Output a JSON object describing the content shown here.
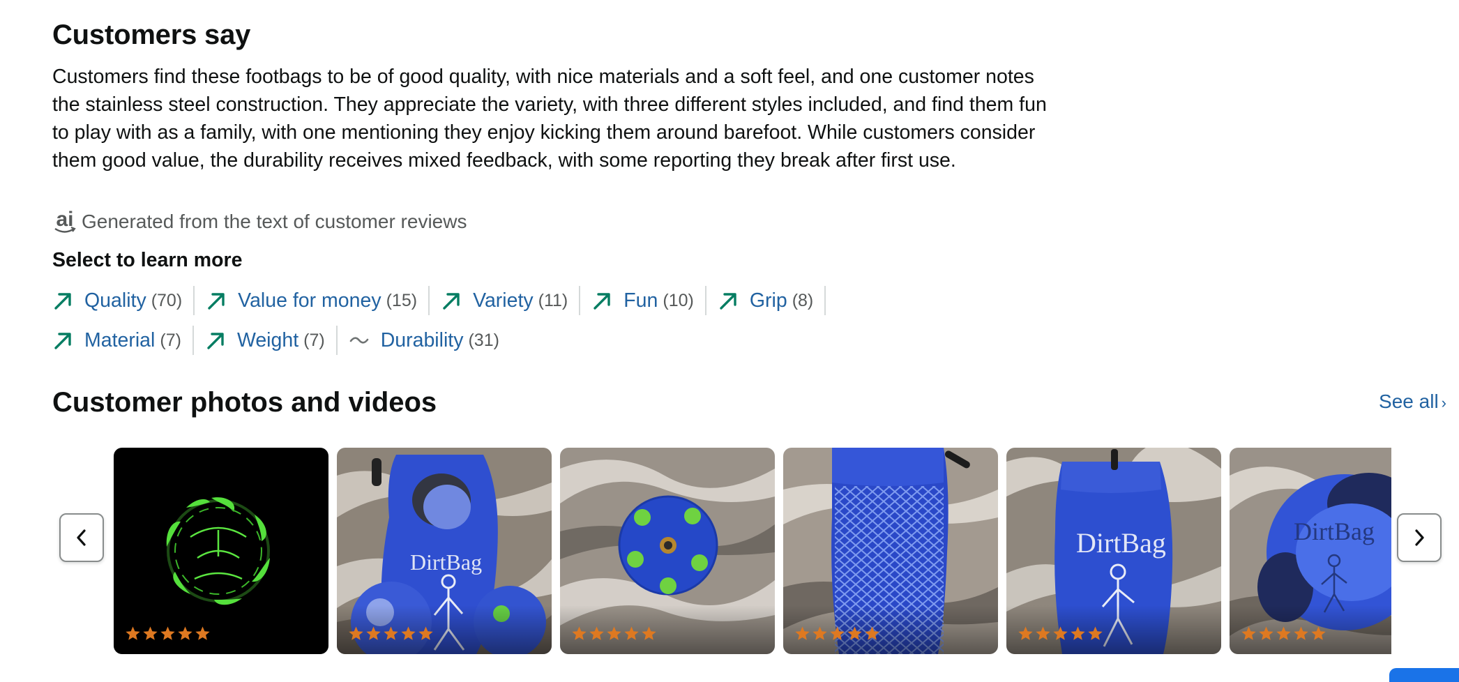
{
  "customers_say": {
    "title": "Customers say",
    "summary": "Customers find these footbags to be of good quality, with nice materials and a soft feel, and one customer notes the stainless steel construction. They appreciate the variety, with three different styles included, and find them fun to play with as a family, with one mentioning they enjoy kicking them around barefoot. While customers consider them good value, the durability receives mixed feedback, with some reporting they break after first use.",
    "ai_logo_text": "ai",
    "ai_note": "Generated from the text of customer reviews",
    "select_heading": "Select to learn more",
    "aspects_row1": [
      {
        "label": "Quality",
        "count": "(70)",
        "trend": "positive"
      },
      {
        "label": "Value for money",
        "count": "(15)",
        "trend": "positive"
      },
      {
        "label": "Variety",
        "count": "(11)",
        "trend": "positive"
      },
      {
        "label": "Fun",
        "count": "(10)",
        "trend": "positive"
      },
      {
        "label": "Grip",
        "count": "(8)",
        "trend": "positive"
      }
    ],
    "aspects_row2": [
      {
        "label": "Material",
        "count": "(7)",
        "trend": "positive"
      },
      {
        "label": "Weight",
        "count": "(7)",
        "trend": "positive"
      },
      {
        "label": "Durability",
        "count": "(31)",
        "trend": "mixed"
      }
    ]
  },
  "photos": {
    "title": "Customer photos and videos",
    "see_all": "See all",
    "items": [
      {
        "rating": 5,
        "subject": "glow-in-the-dark footbag"
      },
      {
        "rating": 5,
        "subject": "DirtBag pouch with three footbags"
      },
      {
        "rating": 5,
        "subject": "green star footbag"
      },
      {
        "rating": 5,
        "subject": "mesh bag"
      },
      {
        "rating": 5,
        "subject": "DirtBag pouch"
      },
      {
        "rating": 5,
        "subject": "blue DirtBag footbag"
      }
    ]
  },
  "colors": {
    "link": "#2162a1",
    "positive_arrow": "#067d62",
    "mixed_trend": "#6f7373",
    "star": "#de7921",
    "muted": "#565959"
  }
}
